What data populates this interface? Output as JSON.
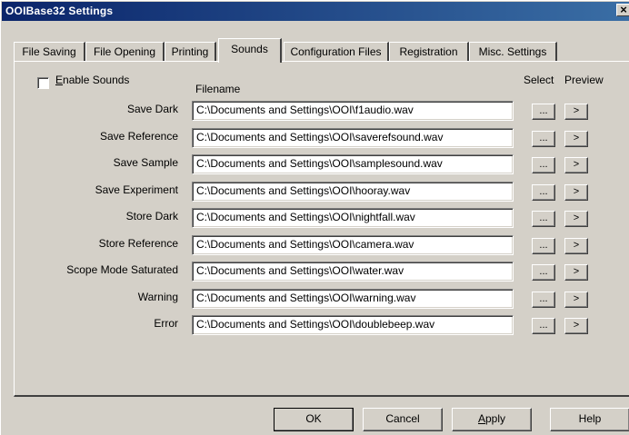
{
  "window": {
    "title": "OOIBase32 Settings",
    "close_glyph": "×"
  },
  "tabs": [
    {
      "label": "File Saving"
    },
    {
      "label": "File Opening"
    },
    {
      "label": "Printing"
    },
    {
      "label": "Sounds",
      "active": true
    },
    {
      "label": "Configuration Files"
    },
    {
      "label": "Registration"
    },
    {
      "label": "Misc. Settings"
    }
  ],
  "sounds": {
    "enable_checkbox": {
      "checked": false,
      "label_first": "E",
      "label_rest": "nable Sounds"
    },
    "headers": {
      "filename": "Filename",
      "select": "Select",
      "preview": "Preview"
    },
    "select_button_label": "...",
    "preview_button_label": ">",
    "rows": [
      {
        "label": "Save Dark",
        "file": "C:\\Documents and Settings\\OOI\\f1audio.wav"
      },
      {
        "label": "Save Reference",
        "file": "C:\\Documents and Settings\\OOI\\saverefsound.wav"
      },
      {
        "label": "Save Sample",
        "file": "C:\\Documents and Settings\\OOI\\samplesound.wav"
      },
      {
        "label": "Save Experiment",
        "file": "C:\\Documents and Settings\\OOI\\hooray.wav"
      },
      {
        "label": "Store Dark",
        "file": "C:\\Documents and Settings\\OOI\\nightfall.wav"
      },
      {
        "label": "Store Reference",
        "file": "C:\\Documents and Settings\\OOI\\camera.wav"
      },
      {
        "label": "Scope Mode Saturated",
        "file": "C:\\Documents and Settings\\OOI\\water.wav"
      },
      {
        "label": "Warning",
        "file": "C:\\Documents and Settings\\OOI\\warning.wav"
      },
      {
        "label": "Error",
        "file": "C:\\Documents and Settings\\OOI\\doublebeep.wav"
      }
    ]
  },
  "buttons": {
    "ok": "OK",
    "cancel": "Cancel",
    "apply_first": "A",
    "apply_rest": "pply",
    "help": "Help"
  },
  "colors": {
    "title_start": "#0a246a",
    "title_end": "#3a6ea5",
    "face": "#d4d0c8"
  }
}
